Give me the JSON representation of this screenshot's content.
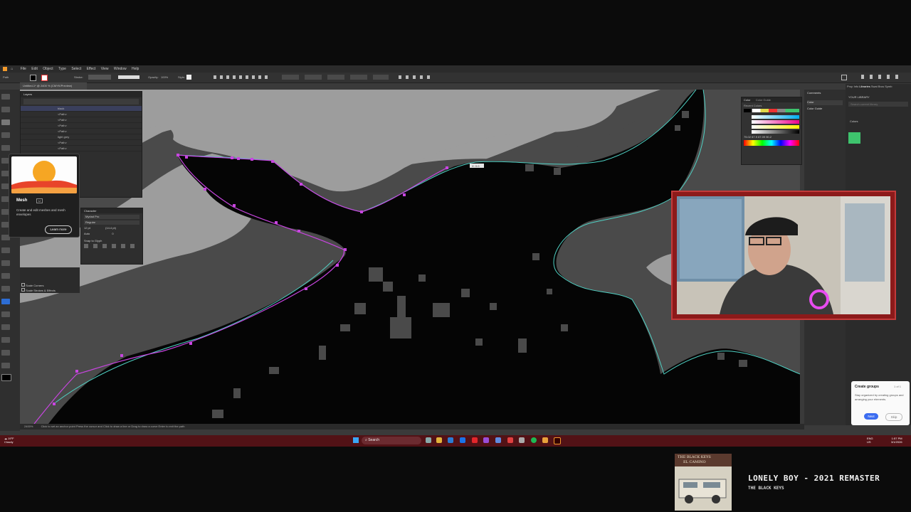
{
  "app": {
    "menu": [
      "File",
      "Edit",
      "Object",
      "Type",
      "Select",
      "Effect",
      "View",
      "Window",
      "Help"
    ],
    "tool_label": "Path",
    "stroke_label": "Stroke:",
    "opacity_label": "Opacity:",
    "opacity_value": "100%",
    "style_label": "Style:",
    "doc_tab": "Untitled-1* @ 2400 % (CMYK/Preview)",
    "anchor_readout": "X: 0.0"
  },
  "layers": {
    "tab": "Layers",
    "rows": [
      "black",
      "<Path>",
      "<Path>",
      "<Path>",
      "<Path>",
      "light grey",
      "<Path>",
      "<Path>"
    ]
  },
  "mesh_card": {
    "title": "Mesh",
    "badge": "U",
    "description": "Create and edit meshes and mesh envelopes",
    "learn_more": "Learn more"
  },
  "character": {
    "tab": "Character",
    "font": "Myriad Pro",
    "style": "Regular",
    "size": "12 pt",
    "leading": "(14.4 pt)",
    "tracking": "Auto",
    "kerning": "0",
    "snap_label": "Snap to Glyph"
  },
  "left_props": {
    "scale_corners": "Scale Corners",
    "scale_strokes": "Scale Strokes & Effects"
  },
  "color_panel": {
    "tabs": [
      "Color",
      "Color Guide"
    ],
    "recent": "Recent Colors",
    "hex": "000000",
    "sliders": [
      "C",
      "M",
      "Y",
      "K"
    ],
    "values": [
      "75.02",
      "67.9",
      "67.09",
      "90.2"
    ]
  },
  "comments_panel": {
    "items": [
      "Comments",
      "Color",
      "Color Guide"
    ]
  },
  "libraries": {
    "tabs": [
      "Prop",
      "Info",
      "Libraries",
      "Swat",
      "Brus",
      "Symb"
    ],
    "library_name": "YOUR LIBRARY",
    "search_placeholder": "Search current library",
    "section": "Colors",
    "swatch_color": "#3ec36d"
  },
  "status_bar": {
    "zoom": "2400%",
    "hint": "Click to set an anchor point    Press the cursor and Click to draw a line or Drag to draw a curve    Enter to exit the path"
  },
  "taskbar": {
    "weather_temp": "19°F",
    "weather_desc": "Cloudy",
    "search": "Search",
    "lang": "ENG",
    "region": "US",
    "time": "1:57 PM",
    "date": "3/1/2026"
  },
  "create_groups": {
    "title": "Create groups",
    "step": "1 of 1",
    "body": "Stay organized by creating groups and arranging your elements.",
    "next": "Next",
    "skip": "Skip"
  },
  "now_playing": {
    "album_line1": "THE BLACK KEYS",
    "album_line2": "EL CAMINO",
    "title": "LONELY BOY - 2021 REMASTER",
    "artist": "THE BLACK KEYS"
  },
  "colors": {
    "path_selection": "#c845e0",
    "path_outline": "#4fd0c3",
    "frame_red": "#8c1a1a",
    "taskbar": "#521216"
  }
}
